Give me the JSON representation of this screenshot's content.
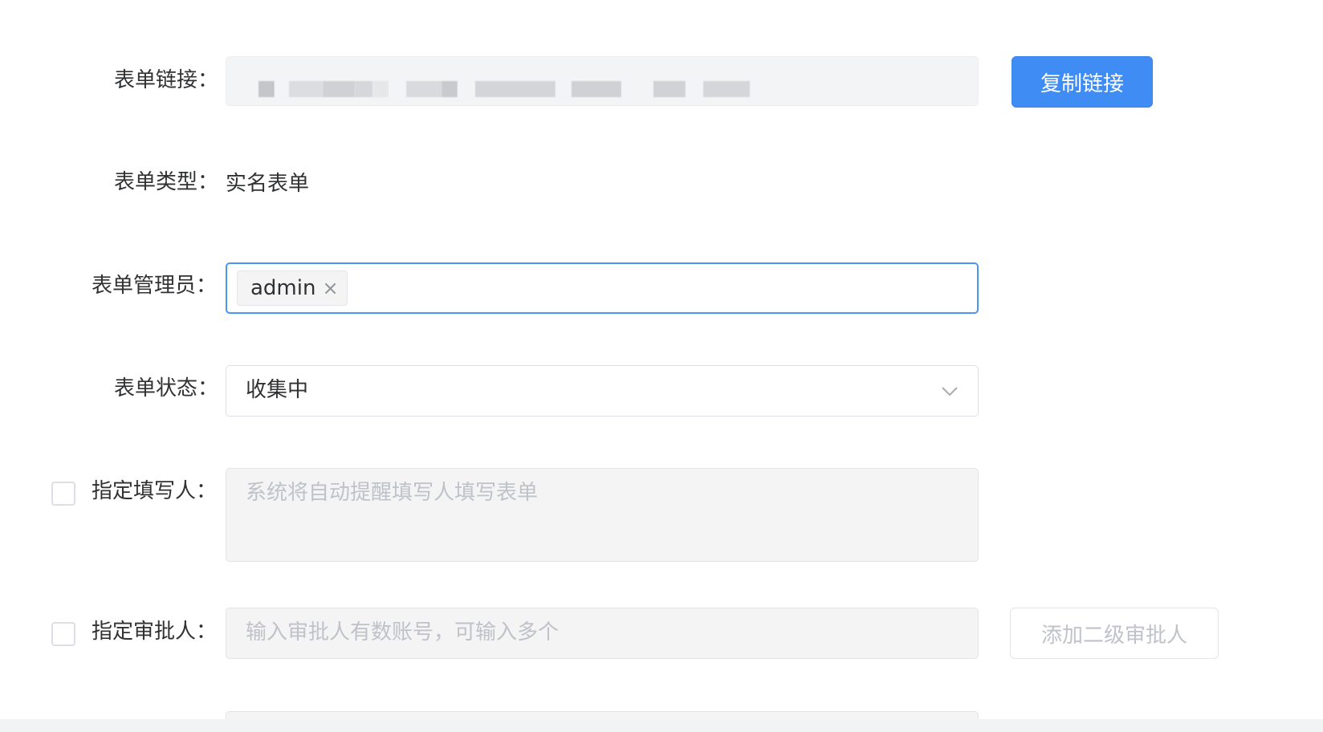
{
  "form": {
    "link": {
      "label": "表单链接：",
      "copy_button": "复制链接"
    },
    "type": {
      "label": "表单类型：",
      "value": "实名表单"
    },
    "admin": {
      "label": "表单管理员：",
      "tags": [
        "admin"
      ],
      "close_glyph": "×"
    },
    "status": {
      "label": "表单状态：",
      "selected": "收集中"
    },
    "fillers": {
      "label": "指定填写人：",
      "placeholder": "系统将自动提醒填写人填写表单",
      "checked": false
    },
    "approver": {
      "label": "指定审批人：",
      "placeholder": "输入审批人有数账号，可输入多个",
      "checked": false,
      "add_button": "添加二级审批人"
    }
  },
  "colors": {
    "primary": "#3f8cf5",
    "focus_border": "#4a93f7",
    "disabled_bg": "#f4f4f5",
    "placeholder": "#bfc2c8"
  },
  "icons": {
    "tag_close": "close-icon",
    "select_arrow": "chevron-down-icon"
  }
}
